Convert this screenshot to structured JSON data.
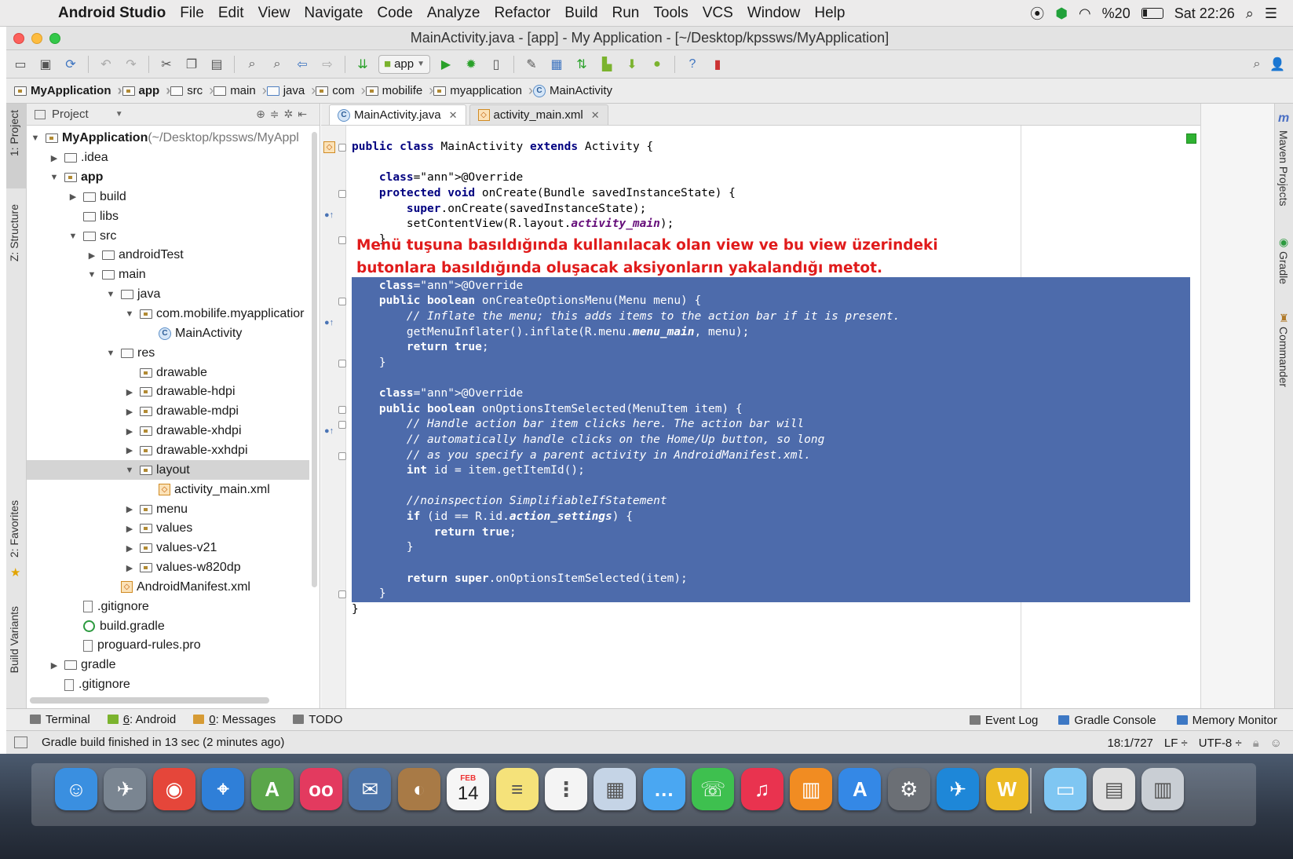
{
  "menubar": {
    "app_name": "Android Studio",
    "items": [
      "File",
      "Edit",
      "View",
      "Navigate",
      "Code",
      "Analyze",
      "Refactor",
      "Build",
      "Run",
      "Tools",
      "VCS",
      "Window",
      "Help"
    ],
    "battery": "%20",
    "clock": "Sat 22:26"
  },
  "window": {
    "title": "MainActivity.java - [app] - My Application - [~/Desktop/kpssws/MyApplication]"
  },
  "toolbar": {
    "run_config": "app"
  },
  "breadcrumb": [
    "MyApplication",
    "app",
    "src",
    "main",
    "java",
    "com",
    "mobilife",
    "myapplication",
    "MainActivity"
  ],
  "left_stripe": {
    "project": "1: Project",
    "structure": "Z: Structure",
    "favorites": "2: Favorites",
    "build_variants": "Build Variants"
  },
  "right_stripe": {
    "maven": "Maven Projects",
    "gradle": "Gradle",
    "commander": "Commander"
  },
  "project_panel": {
    "header": "Project",
    "tree": [
      {
        "label": "MyApplication",
        "hint": " (~/Desktop/kpssws/MyAppl",
        "indent": 0,
        "arrow": "down",
        "icon": "module",
        "bold": true
      },
      {
        "label": ".idea",
        "indent": 1,
        "arrow": "right",
        "icon": "folder"
      },
      {
        "label": "app",
        "indent": 1,
        "arrow": "down",
        "icon": "module",
        "bold": true
      },
      {
        "label": "build",
        "indent": 2,
        "arrow": "right",
        "icon": "folder"
      },
      {
        "label": "libs",
        "indent": 2,
        "arrow": "none",
        "icon": "folder"
      },
      {
        "label": "src",
        "indent": 2,
        "arrow": "down",
        "icon": "folder"
      },
      {
        "label": "androidTest",
        "indent": 3,
        "arrow": "right",
        "icon": "folder"
      },
      {
        "label": "main",
        "indent": 3,
        "arrow": "down",
        "icon": "folder"
      },
      {
        "label": "java",
        "indent": 4,
        "arrow": "down",
        "icon": "folder"
      },
      {
        "label": "com.mobilife.myapplicatior",
        "indent": 5,
        "arrow": "down",
        "icon": "package"
      },
      {
        "label": "MainActivity",
        "indent": 6,
        "arrow": "none",
        "icon": "class"
      },
      {
        "label": "res",
        "indent": 4,
        "arrow": "down",
        "icon": "folder"
      },
      {
        "label": "drawable",
        "indent": 5,
        "arrow": "none",
        "icon": "package"
      },
      {
        "label": "drawable-hdpi",
        "indent": 5,
        "arrow": "right",
        "icon": "package"
      },
      {
        "label": "drawable-mdpi",
        "indent": 5,
        "arrow": "right",
        "icon": "package"
      },
      {
        "label": "drawable-xhdpi",
        "indent": 5,
        "arrow": "right",
        "icon": "package"
      },
      {
        "label": "drawable-xxhdpi",
        "indent": 5,
        "arrow": "right",
        "icon": "package"
      },
      {
        "label": "layout",
        "indent": 5,
        "arrow": "down",
        "icon": "package",
        "selected": true
      },
      {
        "label": "activity_main.xml",
        "indent": 6,
        "arrow": "none",
        "icon": "xml"
      },
      {
        "label": "menu",
        "indent": 5,
        "arrow": "right",
        "icon": "package"
      },
      {
        "label": "values",
        "indent": 5,
        "arrow": "right",
        "icon": "package"
      },
      {
        "label": "values-v21",
        "indent": 5,
        "arrow": "right",
        "icon": "package"
      },
      {
        "label": "values-w820dp",
        "indent": 5,
        "arrow": "right",
        "icon": "package"
      },
      {
        "label": "AndroidManifest.xml",
        "indent": 4,
        "arrow": "none",
        "icon": "xml"
      },
      {
        "label": ".gitignore",
        "indent": 2,
        "arrow": "none",
        "icon": "file"
      },
      {
        "label": "build.gradle",
        "indent": 2,
        "arrow": "none",
        "icon": "gradle"
      },
      {
        "label": "proguard-rules.pro",
        "indent": 2,
        "arrow": "none",
        "icon": "file"
      },
      {
        "label": "gradle",
        "indent": 1,
        "arrow": "right",
        "icon": "folder"
      },
      {
        "label": ".gitignore",
        "indent": 1,
        "arrow": "none",
        "icon": "file"
      }
    ]
  },
  "editor": {
    "tabs": [
      {
        "label": "MainActivity.java",
        "active": true
      },
      {
        "label": "activity_main.xml",
        "active": false
      }
    ],
    "annotation_note": [
      "Menü tuşuna basıldığında kullanılacak olan view ve bu view üzerindeki",
      "butonlara basıldığında  oluşacak aksiyonların yakalandığı metot."
    ],
    "code_lines": [
      "public class MainActivity extends Activity {",
      "",
      "    @Override",
      "    protected void onCreate(Bundle savedInstanceState) {",
      "        super.onCreate(savedInstanceState);",
      "        setContentView(R.layout.activity_main);",
      "    }",
      "",
      "",
      "    @Override",
      "    public boolean onCreateOptionsMenu(Menu menu) {",
      "        // Inflate the menu; this adds items to the action bar if it is present.",
      "        getMenuInflater().inflate(R.menu.menu_main, menu);",
      "        return true;",
      "    }",
      "",
      "    @Override",
      "    public boolean onOptionsItemSelected(MenuItem item) {",
      "        // Handle action bar item clicks here. The action bar will",
      "        // automatically handle clicks on the Home/Up button, so long",
      "        // as you specify a parent activity in AndroidManifest.xml.",
      "        int id = item.getItemId();",
      "",
      "        //noinspection SimplifiableIfStatement",
      "        if (id == R.id.action_settings) {",
      "            return true;",
      "        }",
      "",
      "        return super.onOptionsItemSelected(item);",
      "    }",
      "}"
    ]
  },
  "tool_windows": {
    "terminal": "Terminal",
    "android_num": "6",
    "android": ": Android",
    "messages_num": "0",
    "messages": ": Messages",
    "todo": "TODO",
    "event_log": "Event Log",
    "gradle_console": "Gradle Console",
    "memory_monitor": "Memory Monitor"
  },
  "status": {
    "message": "Gradle build finished in 13 sec (2 minutes ago)",
    "position": "18:1/727",
    "line_sep": "LF ÷",
    "encoding": "UTF-8 ÷"
  },
  "dock": {
    "calendar_month": "FEB",
    "calendar_day": "14"
  },
  "colors": {
    "selection": "#4d6bab",
    "note_red": "#e01b1b",
    "keyword": "#000080"
  }
}
